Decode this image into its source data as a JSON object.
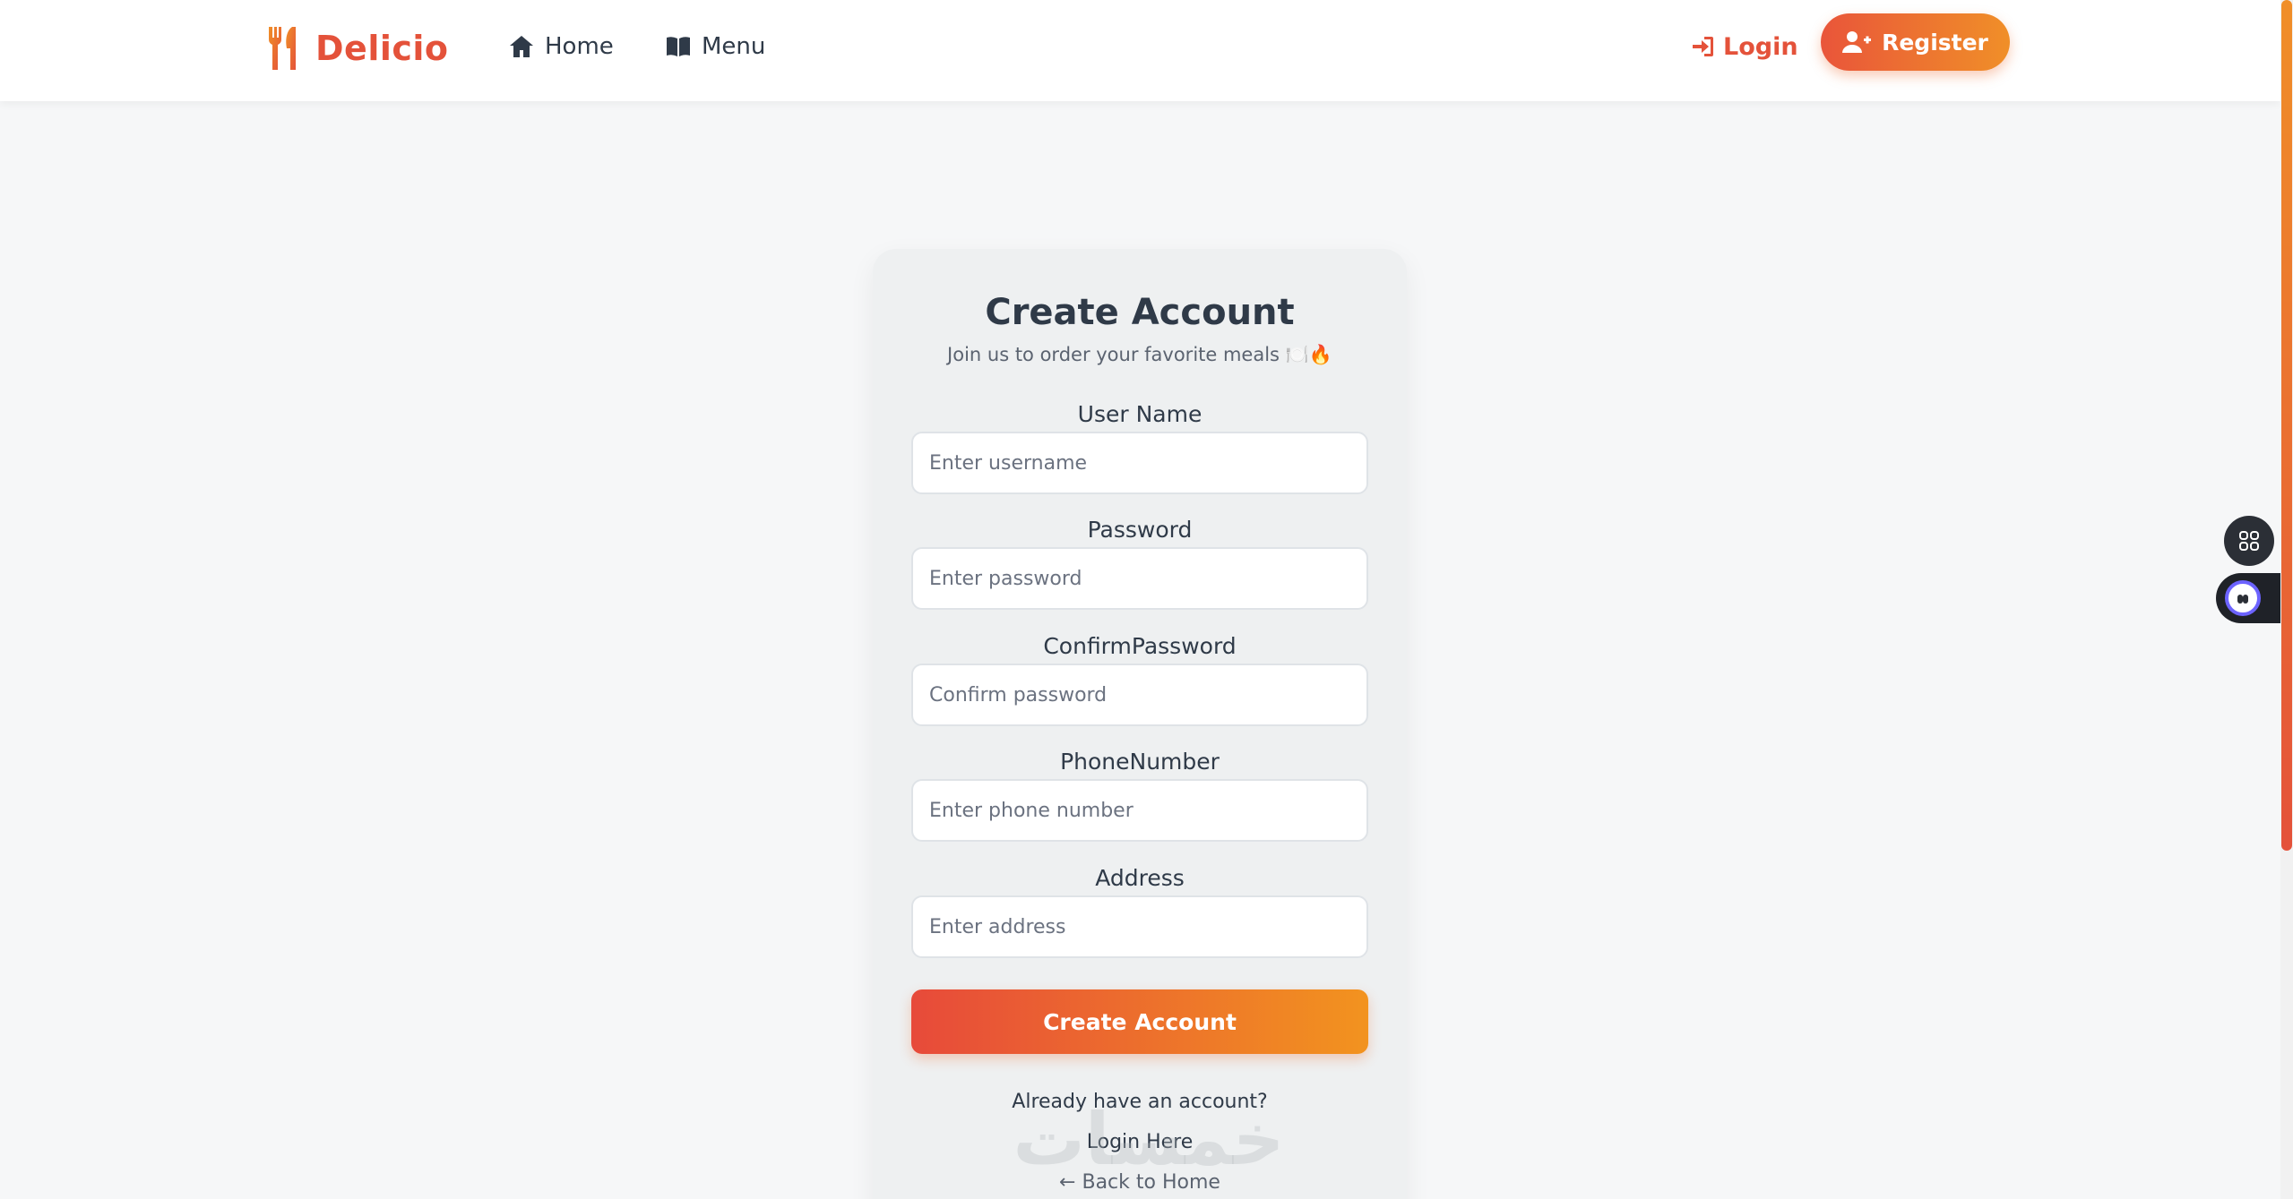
{
  "nav": {
    "brand": "Delicio",
    "links": [
      {
        "label": "Home",
        "icon": "home-icon"
      },
      {
        "label": "Menu",
        "icon": "book-icon"
      }
    ],
    "login": "Login",
    "register": "Register"
  },
  "form": {
    "title": "Create Account",
    "subtitle": "Join us to order your favorite meals 🍽️🔥",
    "fields": [
      {
        "label": "User Name",
        "placeholder": "Enter username",
        "value": ""
      },
      {
        "label": "Password",
        "placeholder": "Enter password",
        "value": ""
      },
      {
        "label": "ConfirmPassword",
        "placeholder": "Confirm password",
        "value": ""
      },
      {
        "label": "PhoneNumber",
        "placeholder": "Enter phone number",
        "value": ""
      },
      {
        "label": "Address",
        "placeholder": "Enter address",
        "value": ""
      }
    ],
    "submit": "Create Account",
    "already": "Already have an account?",
    "login_here": "Login Here",
    "back_home": "← Back to Home"
  },
  "watermark": "خمسات",
  "colors": {
    "accent": "#e4523a",
    "accent_orange": "#f08f28",
    "text": "#2f3a48",
    "card_bg": "#eef0f1",
    "page_bg": "#f6f7f8"
  }
}
